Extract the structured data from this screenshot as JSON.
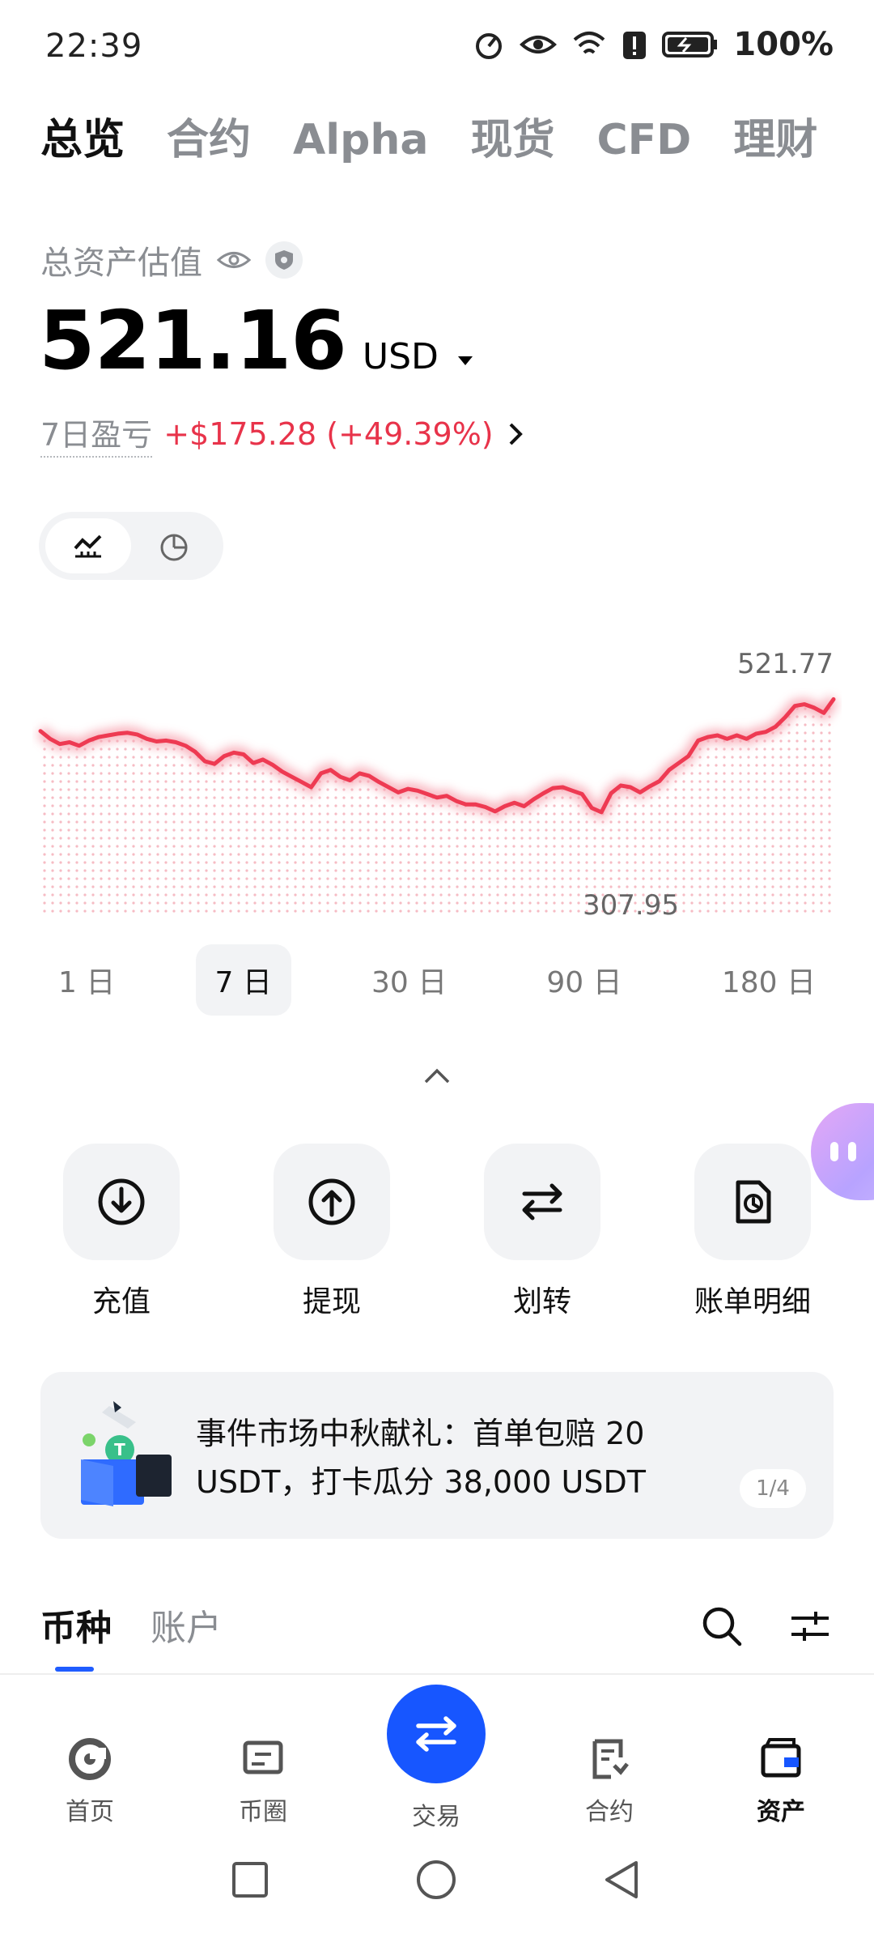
{
  "status_bar": {
    "time": "22:39",
    "battery": "100%"
  },
  "top_tabs": [
    "总览",
    "合约",
    "Alpha",
    "现货",
    "CFD",
    "理财"
  ],
  "asset": {
    "label": "总资产估值",
    "amount": "521.16",
    "currency": "USD",
    "pnl_label": "7日盈亏",
    "pnl_value": "+$175.28 (+49.39%)"
  },
  "chart_data": {
    "type": "line",
    "title": "",
    "range": "7 日",
    "max_label": "521.77",
    "min_label": "307.95",
    "ylim": [
      300,
      525
    ],
    "y": [
      485,
      476,
      470,
      472,
      468,
      474,
      478,
      480,
      482,
      483,
      481,
      476,
      473,
      474,
      472,
      468,
      461,
      450,
      447,
      456,
      460,
      458,
      448,
      452,
      446,
      438,
      432,
      426,
      420,
      436,
      440,
      432,
      428,
      436,
      433,
      426,
      420,
      414,
      418,
      416,
      412,
      408,
      410,
      404,
      400,
      400,
      397,
      392,
      398,
      402,
      398,
      406,
      413,
      419,
      420,
      416,
      412,
      396,
      391,
      413,
      422,
      420,
      414,
      421,
      427,
      440,
      448,
      456,
      474,
      478,
      480,
      476,
      480,
      476,
      482,
      484,
      490,
      501,
      514,
      516,
      512,
      506,
      521.77
    ],
    "color": "#ee3a52"
  },
  "ranges": [
    "1 日",
    "7 日",
    "30 日",
    "90 日",
    "180 日"
  ],
  "actions": [
    {
      "label": "充值",
      "icon": "deposit-icon"
    },
    {
      "label": "提现",
      "icon": "withdraw-icon"
    },
    {
      "label": "划转",
      "icon": "transfer-icon"
    },
    {
      "label": "账单明细",
      "icon": "bill-icon"
    }
  ],
  "banner": {
    "text": "事件市场中秋献礼：首单包赔 20 USDT，打卡瓜分 38,000 USDT",
    "pager": "1/4"
  },
  "sub_tabs": [
    "币种",
    "账户"
  ],
  "bottom_nav": [
    {
      "label": "首页",
      "icon": "home-icon"
    },
    {
      "label": "币圈",
      "icon": "square-icon"
    },
    {
      "label": "交易",
      "icon": "trade-icon"
    },
    {
      "label": "合约",
      "icon": "futures-icon"
    },
    {
      "label": "资产",
      "icon": "wallet-icon"
    }
  ],
  "colors": {
    "accent": "#1756ff",
    "loss_gain_red": "#e8334a"
  }
}
